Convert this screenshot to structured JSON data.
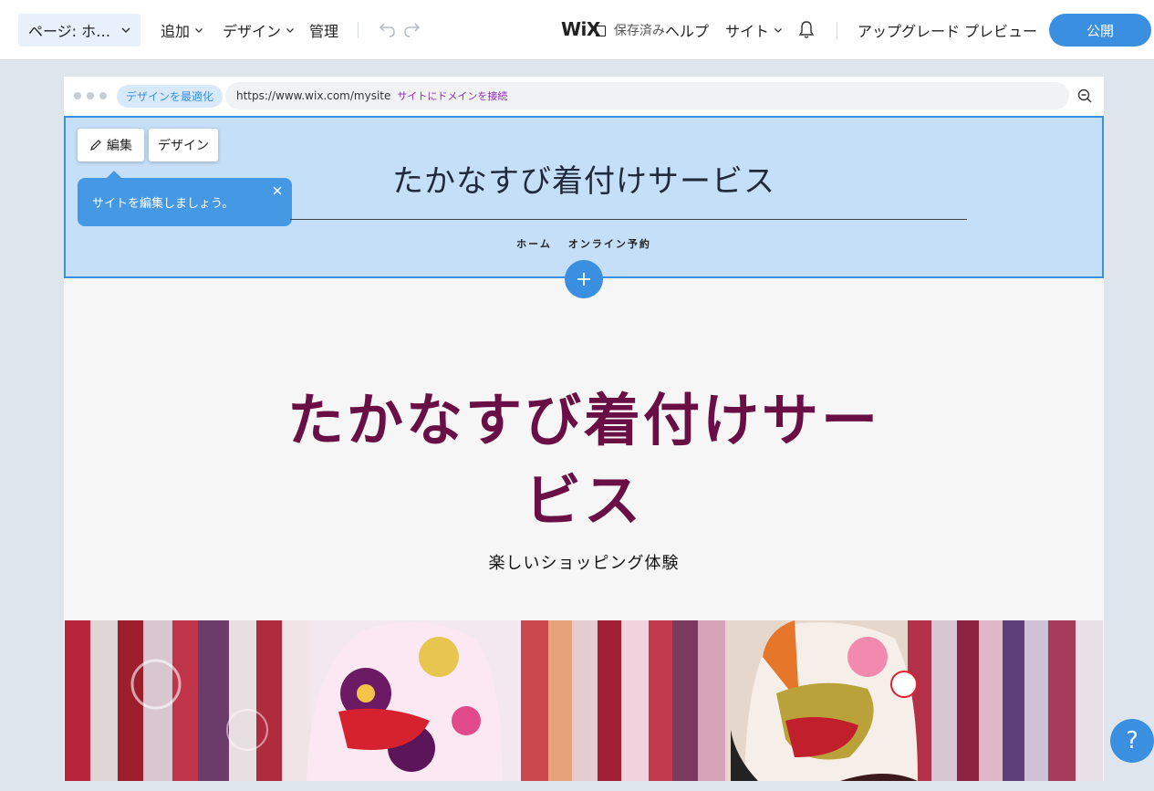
{
  "topbar": {
    "page_selector": "ページ: ホ…",
    "menus": [
      {
        "label": "追加",
        "has_dropdown": true
      },
      {
        "label": "デザイン",
        "has_dropdown": true
      },
      {
        "label": "管理",
        "has_dropdown": false
      }
    ],
    "logo": "WiX",
    "saved_status": "保存済み",
    "help": "ヘルプ",
    "site_menu": "サイト",
    "upgrade": "アップグレード",
    "preview": "プレビュー",
    "publish": "公開"
  },
  "browser": {
    "optimize_label": "デザインを最適化",
    "url": "https://www.wix.com/mysite",
    "connect_domain": "サイトにドメインを接続"
  },
  "header_section": {
    "edit_button": "編集",
    "design_button": "デザイン",
    "tooltip": "サイトを編集しましょう。",
    "site_title": "たかなすび着付けサービス",
    "nav": [
      "ホーム",
      "オンライン予約"
    ]
  },
  "hero": {
    "title": "たかなすび着付けサービス",
    "subtitle": "楽しいショッピング体験"
  },
  "help_button": "?",
  "colors": {
    "accent": "#3b8fe0",
    "header_selected_bg": "#c6dff8",
    "hero_title": "#6a0f45"
  }
}
